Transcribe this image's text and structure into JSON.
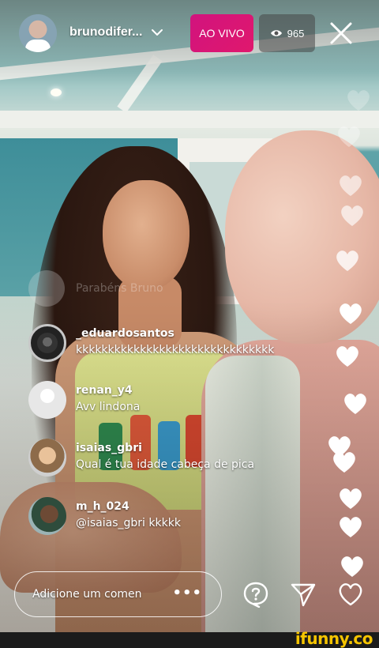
{
  "header": {
    "username": "brunodifer...",
    "live_label": "AO VIVO",
    "viewer_count": "965"
  },
  "faded_comment": "Parabéns Bruno",
  "comments": [
    {
      "user": "_eduardosantos",
      "text": "kkkkkkkkkkkkkkkkkkkkkkkkkkkkkkk"
    },
    {
      "user": "renan_y4",
      "text": "Avv lindona"
    },
    {
      "user": "isaias_gbri",
      "text": "Qual é tua idade cabeça de pica"
    },
    {
      "user": "m_h_024",
      "text": "@isaias_gbri kkkkk"
    }
  ],
  "composer": {
    "placeholder": "Adicione um comen",
    "more": "•••"
  },
  "watermark": "ifunny.co",
  "colors": {
    "live_badge": "#e0186d",
    "heart": "#ffffff",
    "watermark": "#f5c400"
  },
  "icons": [
    "chevron-down-icon",
    "eye-icon",
    "close-icon",
    "question-icon",
    "send-icon",
    "heart-icon"
  ]
}
